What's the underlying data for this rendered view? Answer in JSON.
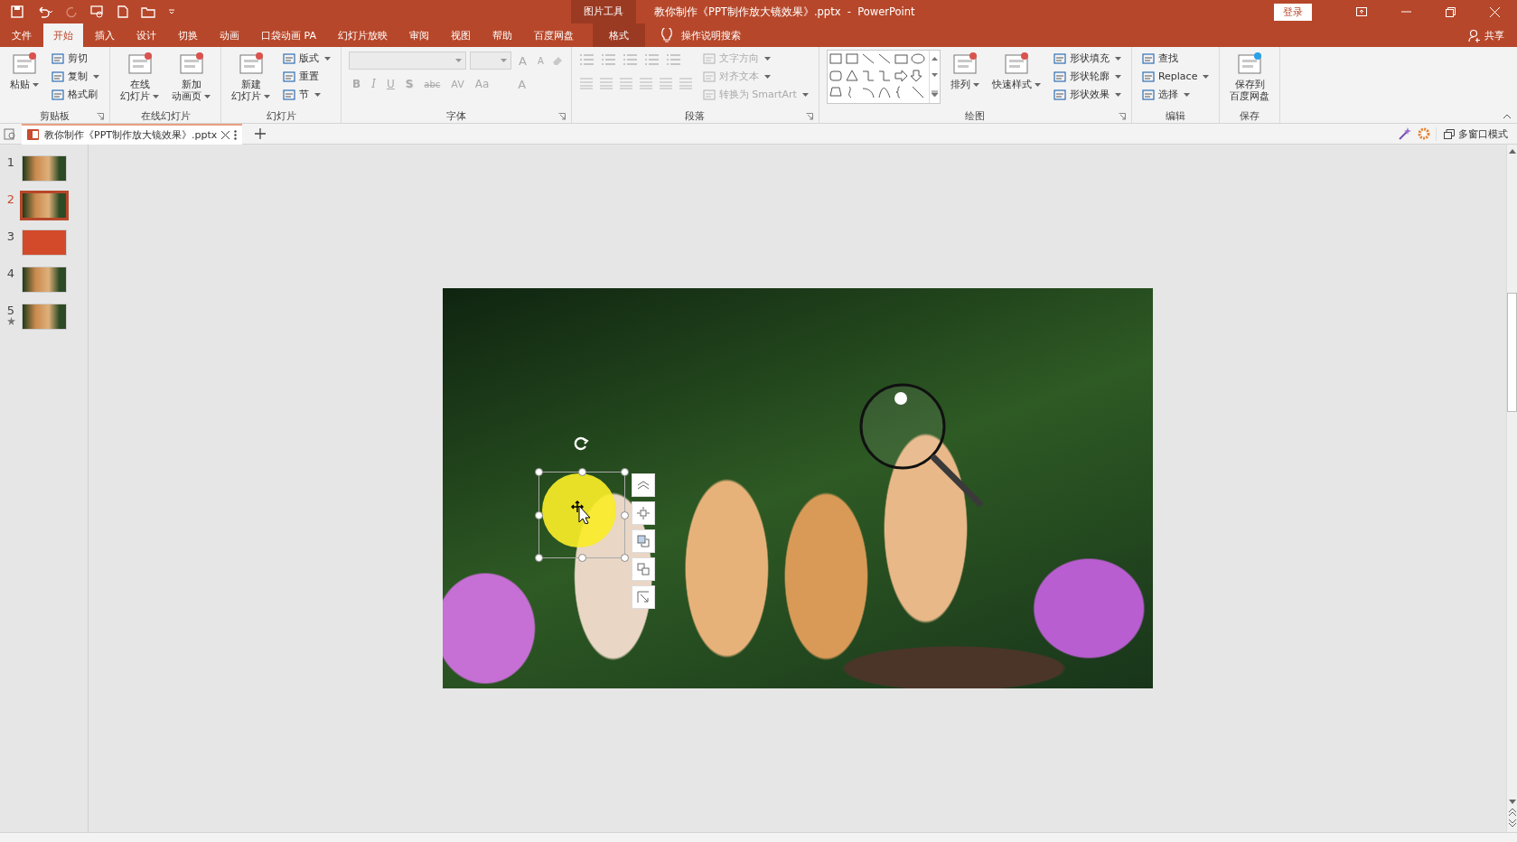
{
  "title_bar": {
    "context_label": "图片工具",
    "title": "教你制作《PPT制作放大镜效果》.pptx  -  PowerPoint",
    "login": "登录"
  },
  "tabs": [
    {
      "label": "文件",
      "selected": false,
      "kind": "normal"
    },
    {
      "label": "开始",
      "selected": true,
      "kind": "normal"
    },
    {
      "label": "插入",
      "selected": false,
      "kind": "normal"
    },
    {
      "label": "设计",
      "selected": false,
      "kind": "normal"
    },
    {
      "label": "切换",
      "selected": false,
      "kind": "normal"
    },
    {
      "label": "动画",
      "selected": false,
      "kind": "normal"
    },
    {
      "label": "口袋动画 PA",
      "selected": false,
      "kind": "normal"
    },
    {
      "label": "幻灯片放映",
      "selected": false,
      "kind": "normal"
    },
    {
      "label": "审阅",
      "selected": false,
      "kind": "normal"
    },
    {
      "label": "视图",
      "selected": false,
      "kind": "normal"
    },
    {
      "label": "帮助",
      "selected": false,
      "kind": "normal"
    },
    {
      "label": "百度网盘",
      "selected": false,
      "kind": "normal"
    },
    {
      "label": "格式",
      "selected": false,
      "kind": "contextual"
    }
  ],
  "tell_me": "操作说明搜索",
  "share": "共享",
  "ribbon": [
    {
      "label": "剪贴板",
      "kind": "standard",
      "launcher": true,
      "items": [
        {
          "kind": "large",
          "lines": [
            "粘贴"
          ],
          "menu": true,
          "disabled": false
        },
        {
          "kind": "small",
          "label": "剪切",
          "menu": false,
          "disabled": false
        },
        {
          "kind": "small",
          "label": "复制",
          "menu": true,
          "disabled": false
        },
        {
          "kind": "small",
          "label": "格式刷",
          "menu": false,
          "disabled": false
        }
      ]
    },
    {
      "label": "在线幻灯片",
      "kind": "standard",
      "launcher": false,
      "items": [
        {
          "kind": "large",
          "lines": [
            "在线",
            "幻灯片"
          ],
          "menu": true,
          "disabled": false
        },
        {
          "kind": "large",
          "lines": [
            "新加",
            "动画页"
          ],
          "menu": true,
          "disabled": false
        }
      ]
    },
    {
      "label": "幻灯片",
      "kind": "standard",
      "launcher": false,
      "items": [
        {
          "kind": "large",
          "lines": [
            "新建",
            "幻灯片"
          ],
          "menu": true,
          "disabled": false
        },
        {
          "kind": "small",
          "label": "版式",
          "menu": true,
          "disabled": false
        },
        {
          "kind": "small",
          "label": "重置",
          "menu": false,
          "disabled": false
        },
        {
          "kind": "small",
          "label": "节",
          "menu": true,
          "disabled": false
        }
      ]
    },
    {
      "label": "字体",
      "kind": "font",
      "launcher": true,
      "items": [
        {
          "kind": "grow",
          "label": "A",
          "disabled": true
        },
        {
          "kind": "shrink",
          "label": "A",
          "disabled": true
        },
        {
          "kind": "bold",
          "label": "B",
          "disabled": true
        },
        {
          "kind": "italic",
          "label": "I",
          "disabled": true
        },
        {
          "kind": "underline",
          "label": "U",
          "disabled": true
        },
        {
          "kind": "shadow",
          "label": "S",
          "disabled": true
        },
        {
          "kind": "strike",
          "label": "abc",
          "disabled": true
        },
        {
          "kind": "spacing",
          "label": "AV",
          "disabled": true
        },
        {
          "kind": "case",
          "label": "Aa",
          "disabled": true
        },
        {
          "kind": "color",
          "label": "A",
          "disabled": true
        }
      ]
    },
    {
      "label": "段落",
      "kind": "paragraph",
      "launcher": true,
      "items": [
        {
          "kind": "small",
          "label": "文字方向",
          "menu": true,
          "disabled": true
        },
        {
          "kind": "small",
          "label": "对齐文本",
          "menu": true,
          "disabled": true
        },
        {
          "kind": "small",
          "label": "转换为 SmartArt",
          "menu": true,
          "disabled": true
        }
      ]
    },
    {
      "label": "绘图",
      "kind": "drawing",
      "launcher": true,
      "items": [
        {
          "kind": "large",
          "lines": [
            "排列"
          ],
          "menu": true,
          "disabled": false
        },
        {
          "kind": "large",
          "lines": [
            "快速样式"
          ],
          "menu": true,
          "disabled": false
        },
        {
          "kind": "small",
          "label": "形状填充",
          "menu": true,
          "disabled": false
        },
        {
          "kind": "small",
          "label": "形状轮廓",
          "menu": true,
          "disabled": false
        },
        {
          "kind": "small",
          "label": "形状效果",
          "menu": true,
          "disabled": false
        }
      ]
    },
    {
      "label": "编辑",
      "kind": "standard",
      "launcher": false,
      "items": [
        {
          "kind": "small",
          "label": "查找",
          "menu": false,
          "disabled": false
        },
        {
          "kind": "small",
          "label": "Replace",
          "menu": true,
          "disabled": false
        },
        {
          "kind": "small",
          "label": "选择",
          "menu": true,
          "disabled": false
        }
      ]
    },
    {
      "label": "保存",
      "kind": "standard",
      "launcher": false,
      "items": [
        {
          "kind": "large",
          "lines": [
            "保存到",
            "百度网盘"
          ],
          "menu": false,
          "disabled": false
        }
      ]
    }
  ],
  "document_tab": {
    "title": "教你制作《PPT制作放大镜效果》.pptx",
    "multi_window": "多窗口模式"
  },
  "slides": [
    {
      "number": "1",
      "selected": false,
      "kind": "photo",
      "animated": false
    },
    {
      "number": "2",
      "selected": true,
      "kind": "photo",
      "animated": false
    },
    {
      "number": "3",
      "selected": false,
      "kind": "title",
      "animated": false
    },
    {
      "number": "4",
      "selected": false,
      "kind": "photo",
      "animated": false
    },
    {
      "number": "5",
      "selected": false,
      "kind": "photo",
      "animated": true
    }
  ]
}
